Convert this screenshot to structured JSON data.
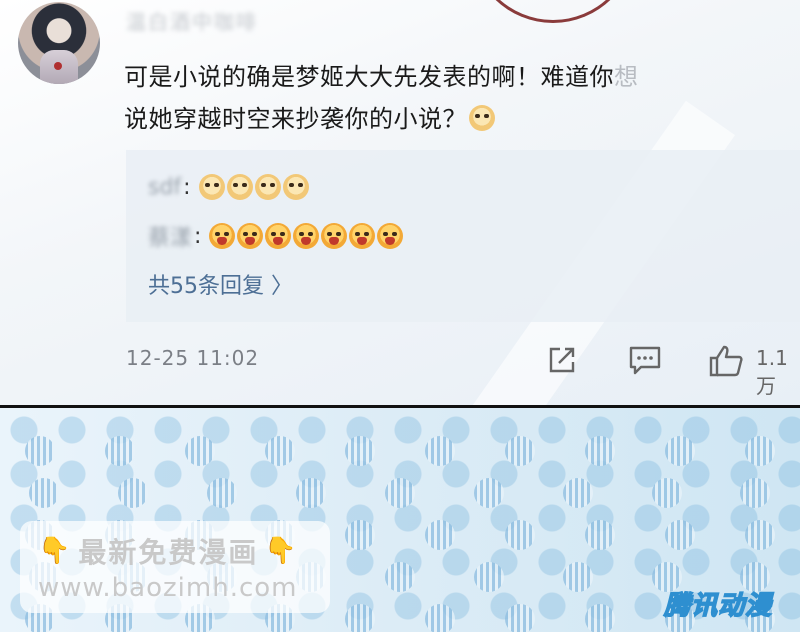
{
  "post": {
    "username": "温白酒中咖啡",
    "text_main": "可是小说的确是梦姬大大先发表的啊！难道你",
    "text_faded": "想",
    "text_line2": "说她穿越时空来抄袭你的小说？",
    "time": "12-25 11:02",
    "like_count": "1.1万"
  },
  "replies": [
    {
      "name": "sdf",
      "colon": ":",
      "emoji": "doge",
      "count": 4
    },
    {
      "name": "蔡漾",
      "colon": ":",
      "emoji": "angry",
      "count": 7
    }
  ],
  "more_replies": "共55条回复 〉",
  "actions": [
    "share-icon",
    "comment-icon",
    "like-icon"
  ],
  "watermark": {
    "line1": "最新免费漫画",
    "line2": "www.baozimh.com",
    "hand": "👇"
  },
  "brand": "腾讯动漫",
  "colors": {
    "link": "#4d6f95",
    "divider": "#111111",
    "accent_blue": "#2e8fd0"
  }
}
